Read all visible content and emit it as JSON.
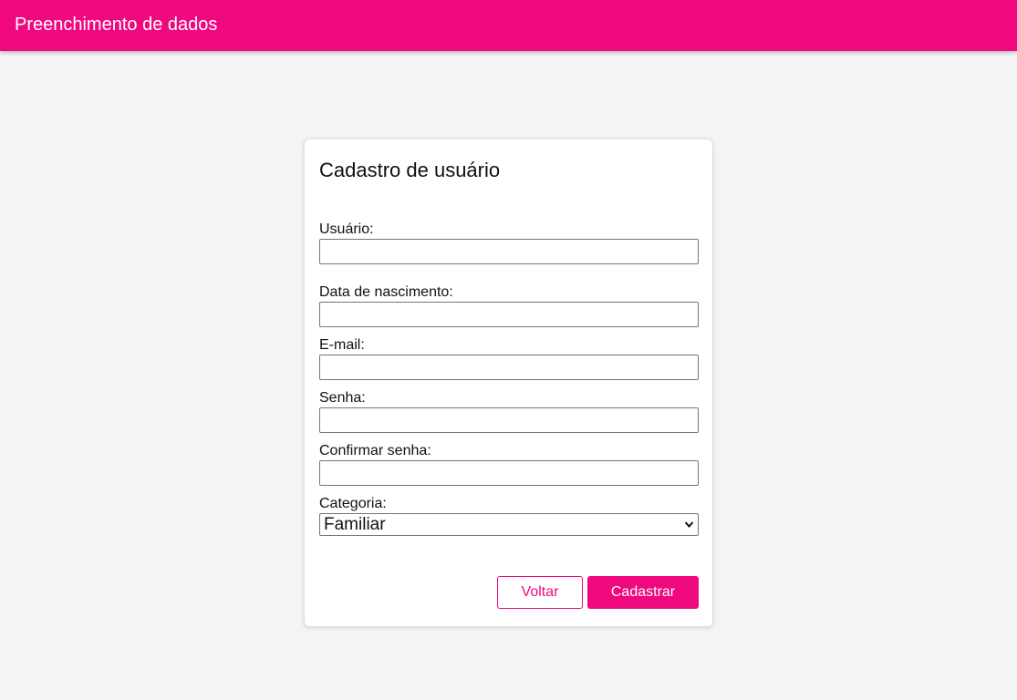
{
  "header": {
    "title": "Preenchimento de dados"
  },
  "form": {
    "title": "Cadastro de usuário",
    "fields": {
      "usuario": {
        "label": "Usuário:",
        "value": ""
      },
      "nascimento": {
        "label": "Data de nascimento:",
        "value": ""
      },
      "email": {
        "label": "E-mail:",
        "value": ""
      },
      "senha": {
        "label": "Senha:",
        "value": ""
      },
      "confirmar": {
        "label": "Confirmar senha:",
        "value": ""
      },
      "categoria": {
        "label": "Categoria:",
        "selected": "Familiar"
      }
    },
    "buttons": {
      "back": "Voltar",
      "submit": "Cadastrar"
    }
  },
  "colors": {
    "accent": "#f0087f",
    "background": "#f4f4f4",
    "card": "#ffffff"
  },
  "icons": {
    "select_arrow": "chevron-down-icon"
  }
}
